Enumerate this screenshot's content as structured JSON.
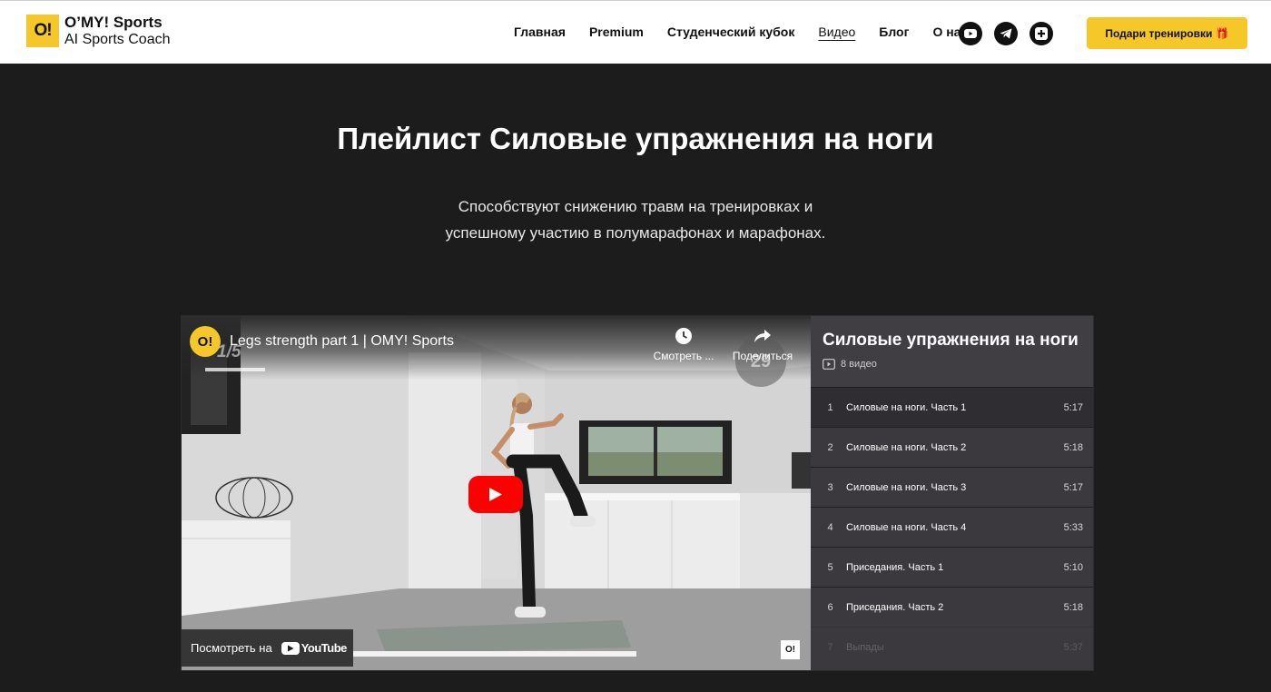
{
  "header": {
    "logo_badge": "O!",
    "logo_line1": "O’MY! Sports",
    "logo_line2": "AI Sports Coach",
    "nav": [
      "Главная",
      "Premium",
      "Студенческий кубок",
      "Видео",
      "Блог",
      "О нас"
    ],
    "active_nav": "Видео",
    "socials": [
      "youtube-icon",
      "telegram-icon",
      "vk-icon"
    ],
    "gift_button": "Подари тренировки 🎁",
    "accent": "#f5c728"
  },
  "hero": {
    "title": "Плейлист Силовые упражнения на ноги",
    "subtitle_line1": "Способствуют снижению травм на тренировках и",
    "subtitle_line2": "успешному участию в полумарафонах и марафонах."
  },
  "video": {
    "channel_badge": "O!",
    "title": "Legs strength part 1 | OMY! Sports",
    "counter": "1/5",
    "watch_later": "Смотреть ...",
    "share": "Поделиться",
    "timer": "29",
    "watch_on": "Посмотреть на",
    "youtube_brand": "YouTube",
    "watermark": "O!",
    "progress": 0.62
  },
  "playlist": {
    "title": "Силовые упражнения на ноги",
    "count": "8 видео",
    "items": [
      {
        "num": "1",
        "title": "Силовые на ноги. Часть 1",
        "duration": "5:17"
      },
      {
        "num": "2",
        "title": "Силовые на ноги. Часть 2",
        "duration": "5:18"
      },
      {
        "num": "3",
        "title": "Силовые на ноги. Часть 3",
        "duration": "5:17"
      },
      {
        "num": "4",
        "title": "Силовые на ноги. Часть 4",
        "duration": "5:33"
      },
      {
        "num": "5",
        "title": "Приседания. Часть 1",
        "duration": "5:10"
      },
      {
        "num": "6",
        "title": "Приседания. Часть 2",
        "duration": "5:18"
      },
      {
        "num": "7",
        "title": "Выпады",
        "duration": "5:37"
      }
    ]
  }
}
